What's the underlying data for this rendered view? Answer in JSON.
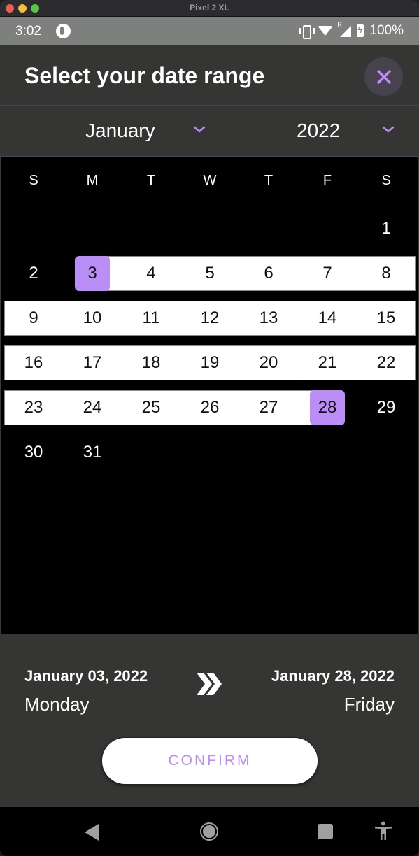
{
  "window": {
    "title": "Pixel 2 XL"
  },
  "status_bar": {
    "time": "3:02",
    "battery": "100%",
    "roaming_indicator": "R"
  },
  "header": {
    "title": "Select your date range",
    "close_icon": "close-icon"
  },
  "selectors": {
    "month": "January",
    "year": "2022"
  },
  "calendar": {
    "weekdays": [
      "S",
      "M",
      "T",
      "W",
      "T",
      "F",
      "S"
    ],
    "weeks": [
      [
        "",
        "",
        "",
        "",
        "",
        "",
        "1"
      ],
      [
        "2",
        "3",
        "4",
        "5",
        "6",
        "7",
        "8"
      ],
      [
        "9",
        "10",
        "11",
        "12",
        "13",
        "14",
        "15"
      ],
      [
        "16",
        "17",
        "18",
        "19",
        "20",
        "21",
        "22"
      ],
      [
        "23",
        "24",
        "25",
        "26",
        "27",
        "28",
        "29"
      ],
      [
        "30",
        "31",
        "",
        "",
        "",
        "",
        ""
      ]
    ],
    "range_start": 3,
    "range_end": 28,
    "accent_color": "#bb8df6"
  },
  "summary": {
    "from_date": "January 03, 2022",
    "from_weekday": "Monday",
    "to_date": "January 28, 2022",
    "to_weekday": "Friday",
    "separator_icon": "double-chevron-right-icon"
  },
  "actions": {
    "confirm_label": "CONFIRM"
  }
}
